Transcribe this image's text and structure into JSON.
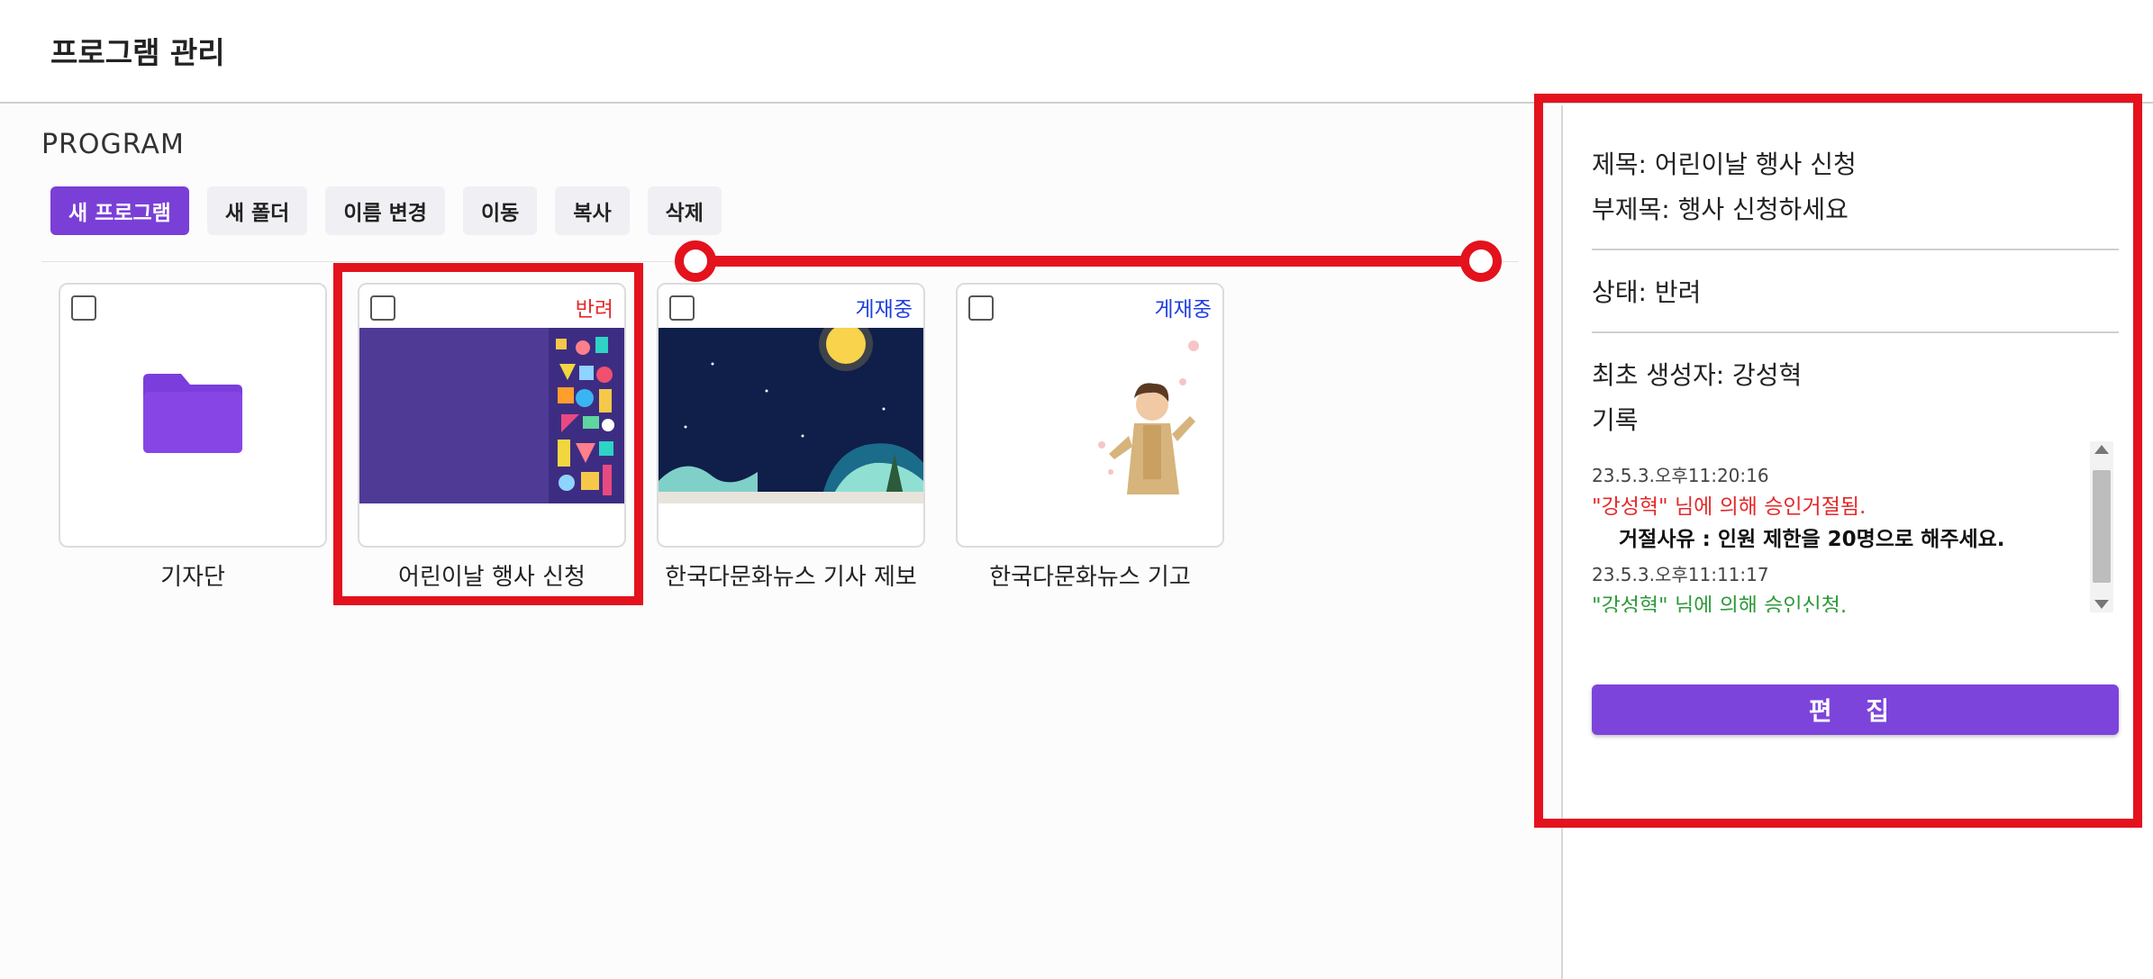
{
  "header": {
    "title": "프로그램 관리"
  },
  "main": {
    "section_label": "PROGRAM",
    "toolbar": [
      {
        "label": "새 프로그램",
        "primary": true
      },
      {
        "label": "새 폴더"
      },
      {
        "label": "이름 변경"
      },
      {
        "label": "이동"
      },
      {
        "label": "복사"
      },
      {
        "label": "삭제"
      }
    ],
    "items": [
      {
        "label": "기자단",
        "type": "folder",
        "status": ""
      },
      {
        "label": "어린이날 행사 신청",
        "type": "program",
        "status": "반려",
        "status_color": "#e5292b"
      },
      {
        "label": "한국다문화뉴스 기사 제보",
        "type": "program",
        "status": "게재중",
        "status_color": "#1f3fe0"
      },
      {
        "label": "한국다문화뉴스 기고",
        "type": "program",
        "status": "게재중",
        "status_color": "#1f3fe0"
      }
    ]
  },
  "detail": {
    "title_line": "제목: 어린이날 행사 신청",
    "subtitle_line": "부제목: 행사 신청하세요",
    "status_line": "상태: 반려",
    "creator_line": "최초 생성자: 강성혁",
    "history_label": "기록",
    "log": [
      {
        "time": "23.5.3.오후11:20:16",
        "message": "\"강성혁\" 님에 의해 승인거절됨.",
        "reason": "거절사유 : 인원 제한을 20명으로 해주세요."
      },
      {
        "time": "23.5.3.오후11:11:17",
        "message": "\"강성혁\" 님에 의해 승인신청."
      }
    ],
    "edit_label": "편 집"
  },
  "colors": {
    "accent": "#7a3fd6",
    "rejected": "#e5292b",
    "published": "#1f3fe0",
    "approved_log": "#2e9a3a",
    "annotation": "#e3121d"
  }
}
